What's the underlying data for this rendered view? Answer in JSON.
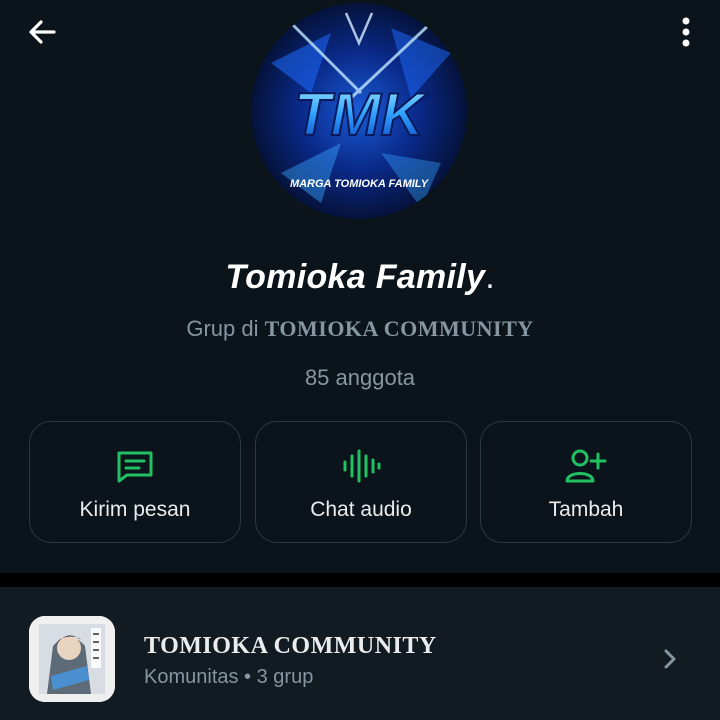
{
  "header": {
    "back_icon": "arrow-left-icon",
    "more_icon": "more-vertical-icon"
  },
  "avatar": {
    "logo_text": "TMK",
    "logo_caption": "MARGA TOMIOKA FAMILY"
  },
  "group": {
    "name": "Tomioka Family",
    "name_suffix": ".",
    "subtitle_prefix": "Grup di ",
    "community": "TOMIOKA COMMUNITY",
    "members": "85 anggota"
  },
  "actions": [
    {
      "label": "Kirim pesan",
      "icon": "message-icon"
    },
    {
      "label": "Chat audio",
      "icon": "audio-wave-icon"
    },
    {
      "label": "Tambah",
      "icon": "add-person-icon"
    }
  ],
  "community_card": {
    "name": "TOMIOKA COMMUNITY",
    "meta": "Komunitas • 3 grup",
    "chevron_icon": "chevron-right-icon"
  },
  "colors": {
    "background": "#0b141a",
    "accent_green": "#21c063",
    "muted_text": "#8696a0",
    "button_border": "#2a3942"
  }
}
